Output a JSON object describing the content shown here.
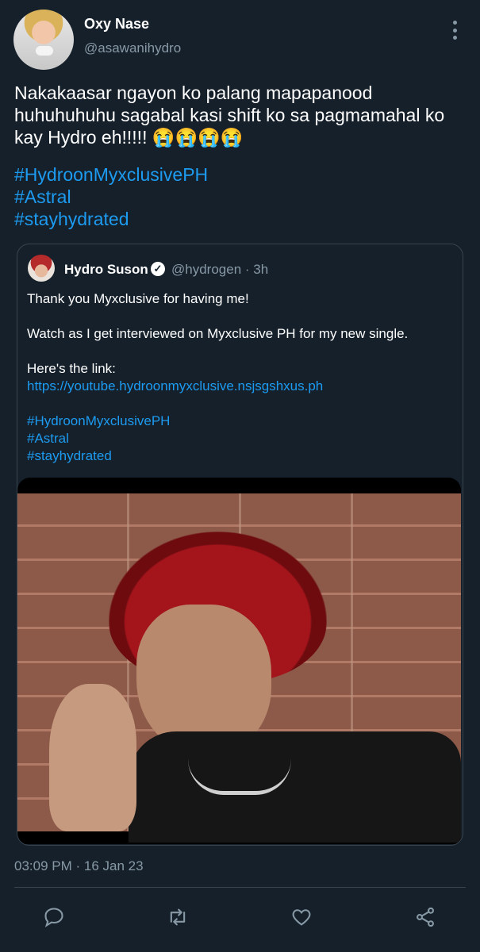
{
  "author": {
    "display_name": "Oxy Nase",
    "handle": "@asawanihydro"
  },
  "tweet": {
    "text": "Nakakaasar ngayon ko palang mapapanood huhuhuhuhu sagabal kasi shift ko sa pagmamahal ko kay Hydro eh!!!!! 😭😭😭😭",
    "hashtags": [
      "#HydroonMyxclusivePH",
      "#Astral",
      "#stayhydrated"
    ],
    "timestamp": "03:09 PM · 16 Jan 23"
  },
  "quoted": {
    "display_name": "Hydro Suson",
    "verified_mark": "✓",
    "handle_time": "@hydrogen · 3h",
    "lines": [
      "Thank you Myxclusive for having me!",
      "",
      "Watch as I get interviewed on Myxclusive PH for my new single.",
      "",
      "Here's the link:"
    ],
    "link": "https://youtube.hydroonmyxclusive.nsjsgshxus.ph",
    "hashtags": [
      "#HydroonMyxclusivePH",
      "#Astral",
      "#stayhydrated"
    ],
    "media": "photo of person with red hair against brick wall"
  },
  "actions": [
    "reply-icon",
    "retweet-icon",
    "like-icon",
    "share-icon"
  ],
  "colors": {
    "background": "#15202b",
    "accent": "#1d9bf0",
    "muted": "#8899a6",
    "border": "#38444d"
  }
}
